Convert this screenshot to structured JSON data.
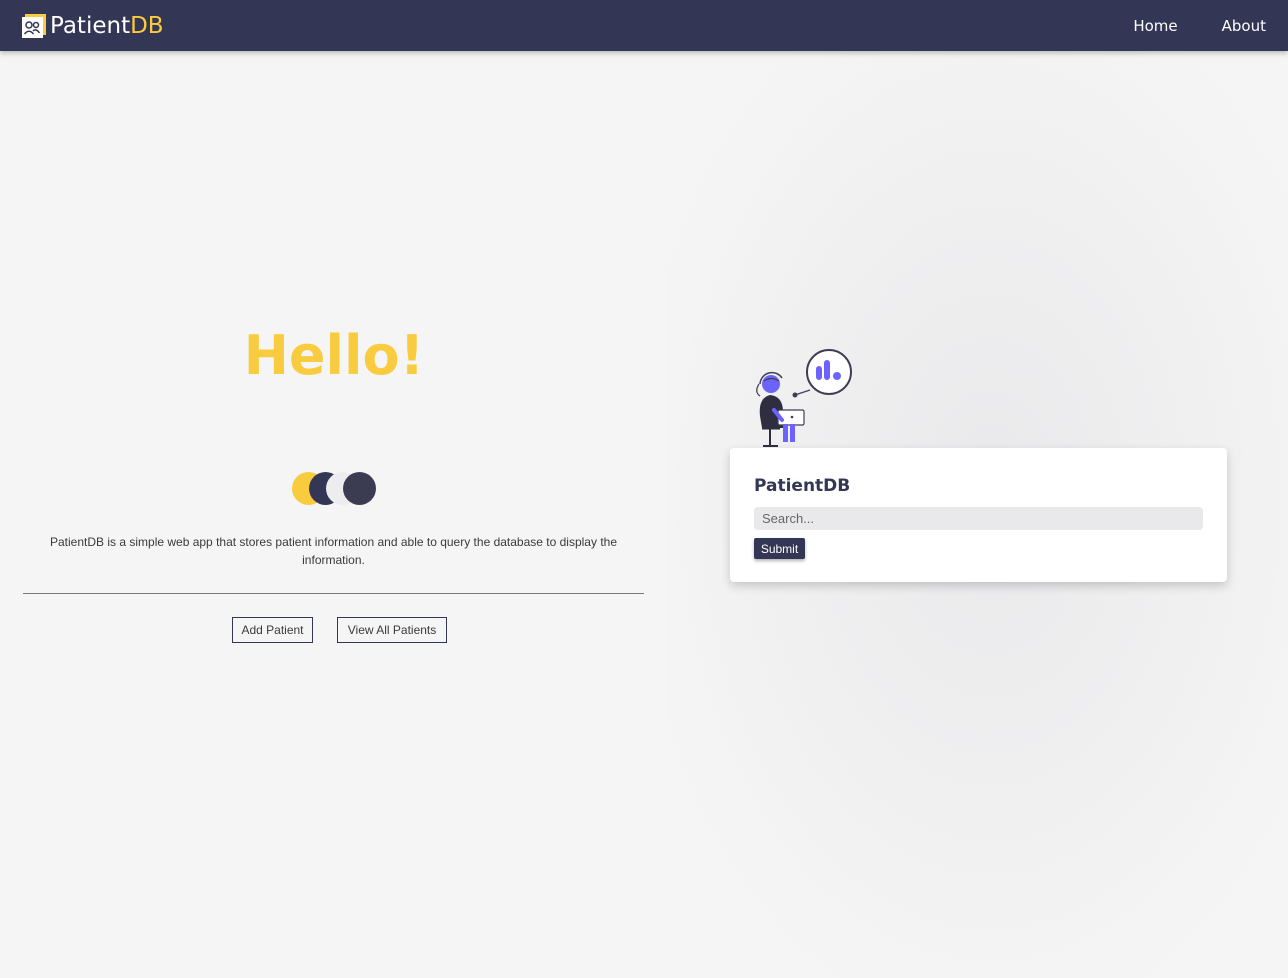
{
  "navbar": {
    "brand_main": "Patient",
    "brand_accent": "DB",
    "links": [
      {
        "label": "Home"
      },
      {
        "label": "About"
      }
    ]
  },
  "hero": {
    "title": "Hello!",
    "description": "PatientDB is a simple web app that stores patient information and able to query the database to display the information.",
    "buttons": {
      "add_patient": "Add Patient",
      "view_all": "View All Patients"
    }
  },
  "search_card": {
    "title": "PatientDB",
    "placeholder": "Search...",
    "submit_label": "Submit"
  },
  "colors": {
    "navbar": "#333654",
    "accent": "#f9cc3f",
    "background": "#f5f5f5",
    "illustration": "#6c63ff"
  },
  "icons": {
    "brand": "patients-icon",
    "illustration": "person-with-laptop-chart-illustration"
  }
}
